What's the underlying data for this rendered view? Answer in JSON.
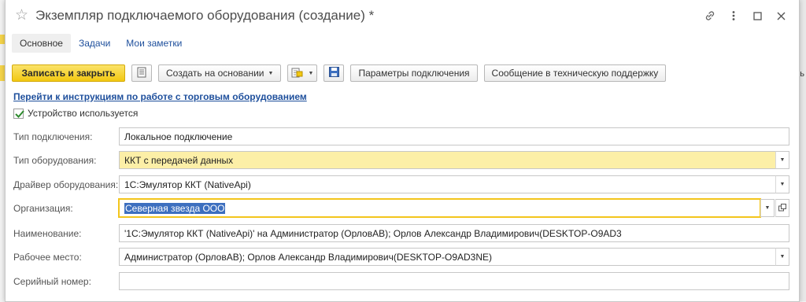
{
  "window": {
    "title": "Экземпляр подключаемого оборудования (создание) *"
  },
  "tabs": [
    {
      "label": "Основное"
    },
    {
      "label": "Задачи"
    },
    {
      "label": "Мои заметки"
    }
  ],
  "toolbar": {
    "save_close_label": "Записать и закрыть",
    "create_based_label": "Создать на основании",
    "connection_params_label": "Параметры подключения",
    "support_message_label": "Сообщение в техническую поддержку"
  },
  "instructions_link": "Перейти к инструкциям по работе с торговым оборудованием",
  "device_used": {
    "label": "Устройство используется",
    "checked": true
  },
  "form": {
    "connection_type": {
      "label": "Тип подключения:",
      "value": "Локальное подключение"
    },
    "equipment_type": {
      "label": "Тип оборудования:",
      "value": "ККТ с передачей данных"
    },
    "driver": {
      "label": "Драйвер оборудования:",
      "value": "1С:Эмулятор ККТ (NativeApi)"
    },
    "organization": {
      "label": "Организация:",
      "value": "Северная звезда ООО"
    },
    "name": {
      "label": "Наименование:",
      "value": "'1С:Эмулятор ККТ (NativeApi)' на Администратор (ОрловАВ); Орлов Александр Владимирович(DESKTOP-O9AD3"
    },
    "workplace": {
      "label": "Рабочее место:",
      "value": "Администратор (ОрловАВ); Орлов Александр Владимирович(DESKTOP-O9AD3NE)"
    },
    "serial": {
      "label": "Серийный номер:",
      "value": ""
    }
  },
  "background": {
    "right_fragment": "ь"
  },
  "icons": [
    "star-icon",
    "link-icon",
    "more-icon",
    "maximize-icon",
    "close-icon",
    "list-icon",
    "document-dropdown-icon",
    "save-disk-icon",
    "checkmark-icon",
    "open-icon"
  ],
  "colors": {
    "primary_button": "#f2c811",
    "link": "#1e4f9c",
    "highlight_field": "#fcefa7",
    "selection": "#3d6fbf"
  }
}
